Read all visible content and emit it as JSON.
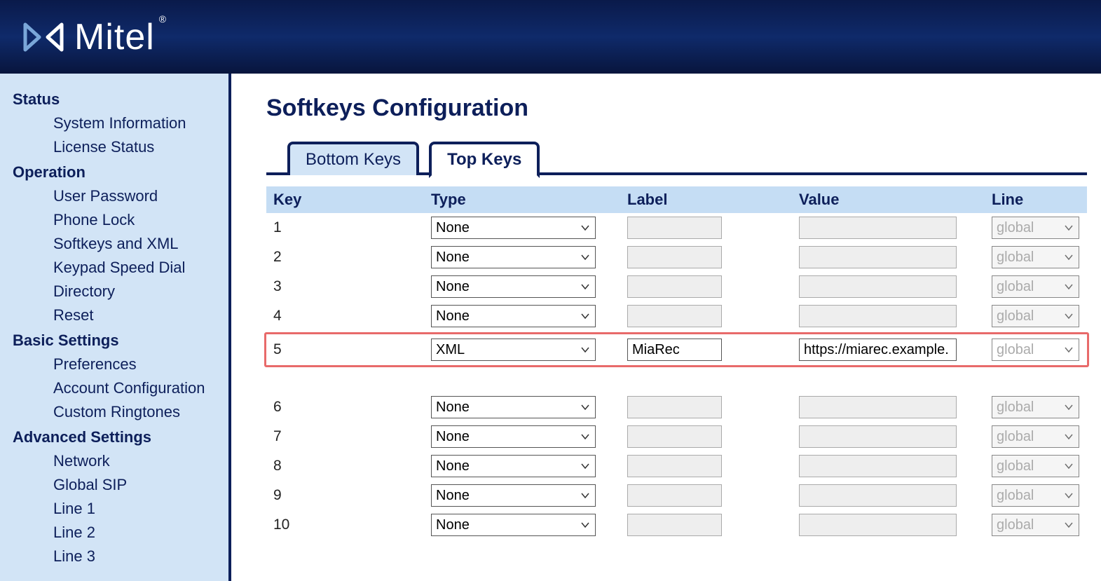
{
  "brand": "Mitel",
  "page_title": "Softkeys Configuration",
  "tabs": [
    {
      "label": "Bottom Keys",
      "active": false
    },
    {
      "label": "Top Keys",
      "active": true
    }
  ],
  "sidebar": [
    {
      "heading": "Status",
      "items": [
        "System Information",
        "License Status"
      ]
    },
    {
      "heading": "Operation",
      "items": [
        "User Password",
        "Phone Lock",
        "Softkeys and XML",
        "Keypad Speed Dial",
        "Directory",
        "Reset"
      ]
    },
    {
      "heading": "Basic Settings",
      "items": [
        "Preferences",
        "Account Configuration",
        "Custom Ringtones"
      ]
    },
    {
      "heading": "Advanced Settings",
      "items": [
        "Network",
        "Global SIP",
        "Line 1",
        "Line 2",
        "Line 3"
      ]
    }
  ],
  "columns": {
    "key": "Key",
    "type": "Type",
    "label": "Label",
    "value": "Value",
    "line": "Line"
  },
  "rows": [
    {
      "key": "1",
      "type": "None",
      "label": "",
      "value": "",
      "line": "global",
      "highlight": false,
      "enabled": false
    },
    {
      "key": "2",
      "type": "None",
      "label": "",
      "value": "",
      "line": "global",
      "highlight": false,
      "enabled": false
    },
    {
      "key": "3",
      "type": "None",
      "label": "",
      "value": "",
      "line": "global",
      "highlight": false,
      "enabled": false
    },
    {
      "key": "4",
      "type": "None",
      "label": "",
      "value": "",
      "line": "global",
      "highlight": false,
      "enabled": false
    },
    {
      "key": "5",
      "type": "XML",
      "label": "MiaRec",
      "value": "https://miarec.example.",
      "line": "global",
      "highlight": true,
      "enabled": true
    },
    {
      "gap": true
    },
    {
      "key": "6",
      "type": "None",
      "label": "",
      "value": "",
      "line": "global",
      "highlight": false,
      "enabled": false
    },
    {
      "key": "7",
      "type": "None",
      "label": "",
      "value": "",
      "line": "global",
      "highlight": false,
      "enabled": false
    },
    {
      "key": "8",
      "type": "None",
      "label": "",
      "value": "",
      "line": "global",
      "highlight": false,
      "enabled": false
    },
    {
      "key": "9",
      "type": "None",
      "label": "",
      "value": "",
      "line": "global",
      "highlight": false,
      "enabled": false
    },
    {
      "key": "10",
      "type": "None",
      "label": "",
      "value": "",
      "line": "global",
      "highlight": false,
      "enabled": false
    }
  ]
}
